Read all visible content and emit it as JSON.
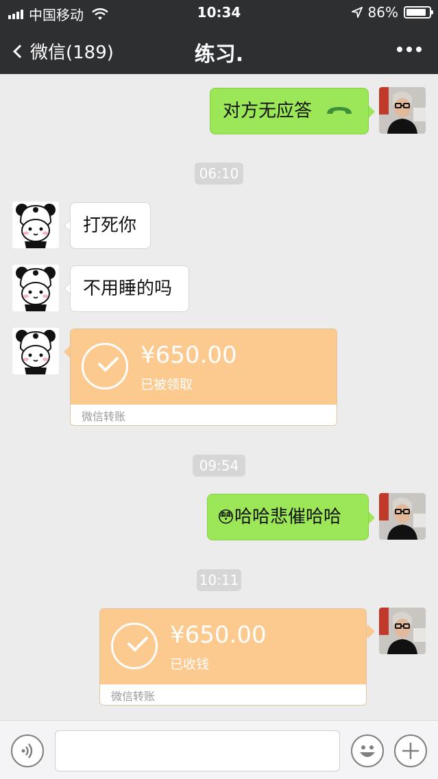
{
  "status_bar": {
    "carrier": "中国移动",
    "time": "10:34",
    "battery": "86%",
    "battery_level": 0.86
  },
  "nav": {
    "back_label": "微信(189)",
    "title": "练习."
  },
  "messages": {
    "m1": {
      "text": "对方无应答"
    },
    "ts1": "06:10",
    "m2": {
      "text": "打死你"
    },
    "m3": {
      "text": "不用睡的吗"
    },
    "m4": {
      "amount": "¥650.00",
      "status": "已被领取",
      "footer": "微信转账"
    },
    "ts2": "09:54",
    "m5": {
      "text": "哈哈悲催哈哈",
      "emoji": "😳"
    },
    "ts3": "10:11",
    "m6": {
      "amount": "¥650.00",
      "status": "已收钱",
      "footer": "微信转账"
    }
  },
  "colors": {
    "header_bg": "#2e2f31",
    "chat_bg": "#ececec",
    "bubble_green": "#9be758",
    "transfer_orange": "#fcca8f"
  },
  "input_bar": {
    "voice_icon": "voice-icon",
    "emoji_icon": "smiley-icon",
    "plus_icon": "plus-icon"
  }
}
